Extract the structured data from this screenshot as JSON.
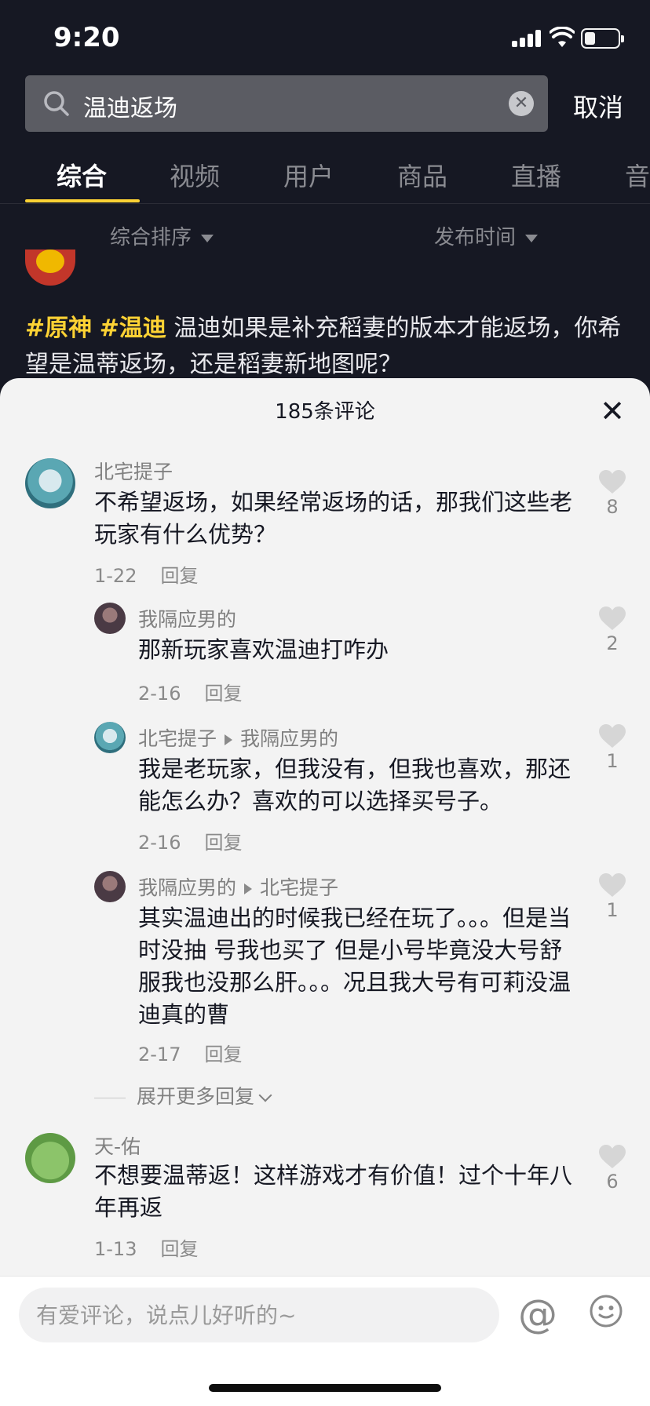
{
  "status_bar": {
    "time": "9:20"
  },
  "search": {
    "query": "温迪返场",
    "cancel_label": "取消"
  },
  "tabs": [
    {
      "label": "综合"
    },
    {
      "label": "视频"
    },
    {
      "label": "用户"
    },
    {
      "label": "商品"
    },
    {
      "label": "直播"
    },
    {
      "label": "音"
    }
  ],
  "filters": {
    "sort_label": "综合排序",
    "time_label": "发布时间"
  },
  "post": {
    "hashtag1": "#原神",
    "hashtag2": "#温迪",
    "text": "温迪如果是补充稻妻的版本才能返场，你希望是温蒂返场，还是稻妻新地图呢？"
  },
  "comments_sheet": {
    "title": "185条评论",
    "comments": [
      {
        "user": "北宅提子",
        "text": "不希望返场，如果经常返场的话，那我们这些老玩家有什么优势？",
        "date": "1-22",
        "reply_label": "回复",
        "likes": "8"
      },
      {
        "user": "我隔应男的",
        "text": "那新玩家喜欢温迪打咋办",
        "date": "2-16",
        "reply_label": "回复",
        "likes": "2"
      },
      {
        "user": "北宅提子",
        "reply_to": "我隔应男的",
        "text": "我是老玩家，但我没有，但我也喜欢，那还能怎么办？喜欢的可以选择买号子。",
        "date": "2-16",
        "reply_label": "回复",
        "likes": "1"
      },
      {
        "user": "我隔应男的",
        "reply_to": "北宅提子",
        "text": "其实温迪出的时候我已经在玩了。。。但是当时没抽 号我也买了 但是小号毕竟没大号舒服我也没那么肝。。。况且我大号有可莉没温迪真的曹",
        "date": "2-17",
        "reply_label": "回复",
        "likes": "1"
      },
      {
        "user": "天-佑",
        "text": "不想要温蒂返！这样游戏才有价值！过个十年八年再返",
        "date": "1-13",
        "reply_label": "回复",
        "likes": "6"
      }
    ],
    "expand_label": "展开更多回复"
  },
  "input": {
    "placeholder": "有爱评论，说点儿好听的~"
  },
  "icons": [
    "search-icon",
    "clear-icon",
    "close-icon",
    "heart-icon",
    "at-icon",
    "emoji-icon"
  ],
  "colors": {
    "accent": "#fdd234",
    "background": "#161823",
    "sheet": "#f3f3f3"
  }
}
